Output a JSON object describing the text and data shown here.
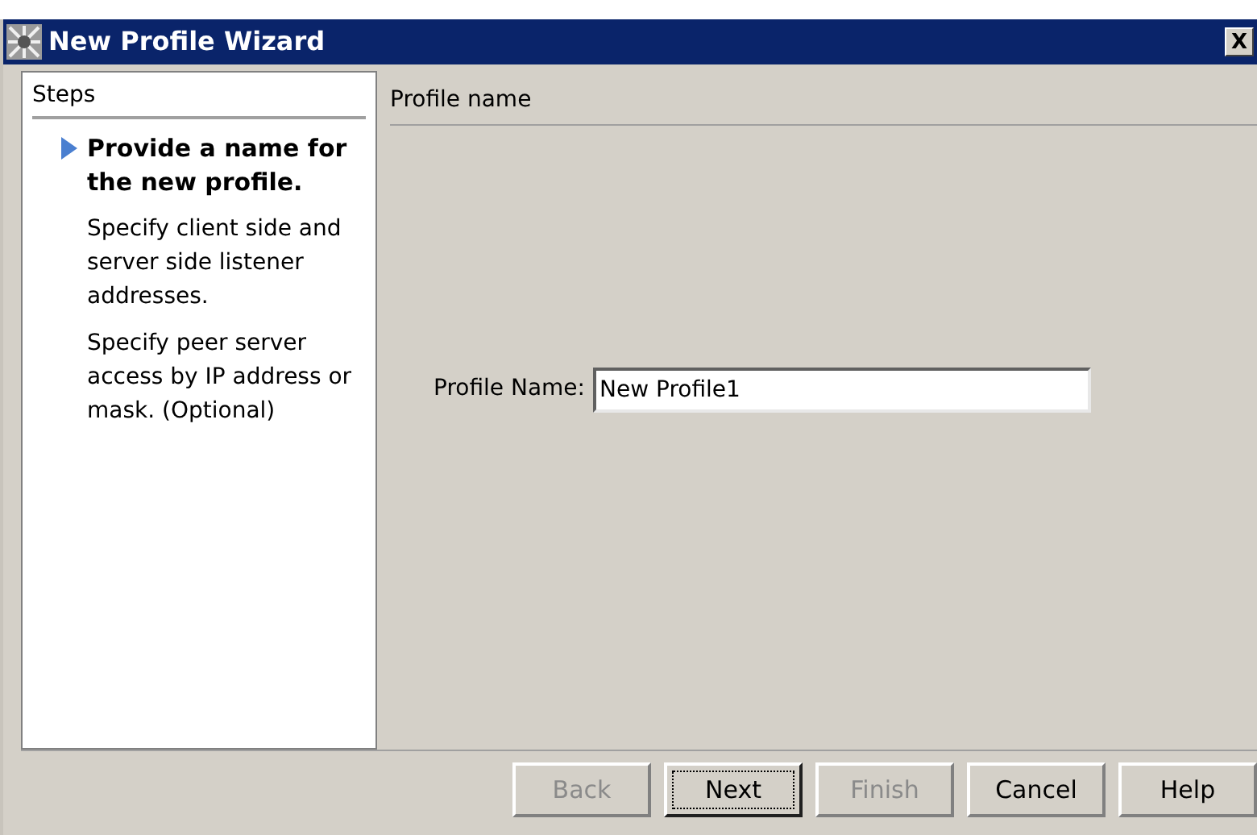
{
  "window": {
    "title": "New Profile Wizard",
    "close": "X"
  },
  "steps": {
    "title": "Steps",
    "items": [
      {
        "label": "Provide a name for the new profile.",
        "selected": true
      },
      {
        "label": "Specify client side and server side listener addresses.",
        "selected": false
      },
      {
        "label": "Specify peer server access by IP address or mask. (Optional)",
        "selected": false
      }
    ]
  },
  "panel": {
    "title": "Profile name",
    "field": {
      "label": "Profile Name:",
      "value": "New Profile1"
    }
  },
  "buttons": [
    {
      "label": "Back",
      "disabled": true,
      "focused": false
    },
    {
      "label": "Next",
      "disabled": false,
      "focused": true
    },
    {
      "label": "Finish",
      "disabled": true,
      "focused": false
    },
    {
      "label": "Cancel",
      "disabled": false,
      "focused": false
    },
    {
      "label": "Help",
      "disabled": false,
      "focused": false
    }
  ]
}
